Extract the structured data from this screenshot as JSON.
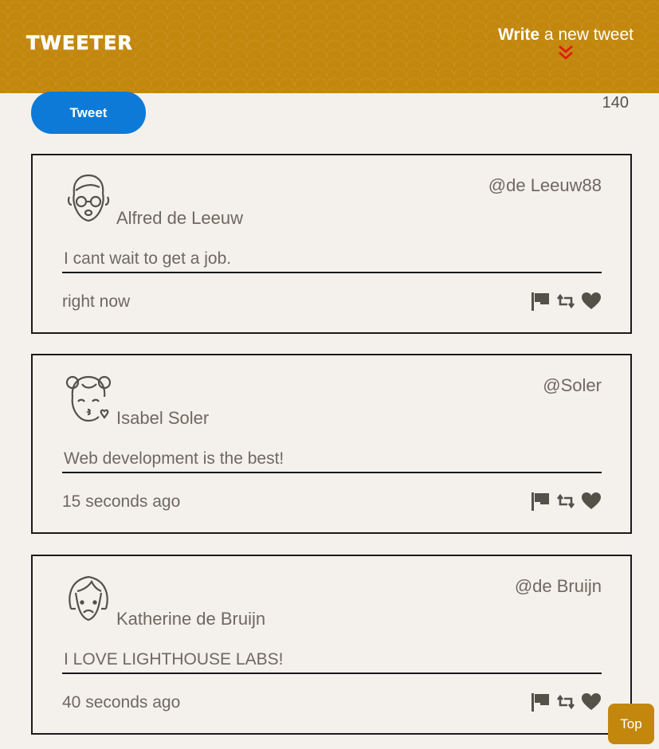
{
  "nav": {
    "brand": "TWEETER",
    "compose_bold": "Write",
    "compose_rest": " a new tweet",
    "compose_icon": "double-chevron-down-icon"
  },
  "composer": {
    "tweet_label": "Tweet",
    "char_count": "140"
  },
  "tweets": [
    {
      "name": "Alfred de Leeuw",
      "handle": "@de Leeuw88",
      "content": "I cant wait to get a job.",
      "time": "right now",
      "avatar": "glasses-person-icon"
    },
    {
      "name": "Isabel Soler",
      "handle": "@Soler",
      "content": "Web development is the best!",
      "time": "15 seconds ago",
      "avatar": "kissing-person-icon"
    },
    {
      "name": "Katherine de Bruijn",
      "handle": "@de Bruijn",
      "content": "I LOVE LIGHTHOUSE LABS!",
      "time": "40 seconds ago",
      "avatar": "sad-person-icon"
    }
  ],
  "scroll_top_label": "Top",
  "colors": {
    "nav_bg": "#c3870e",
    "page_bg": "#f4f1ec",
    "tweet_button": "#0d7ad8",
    "arrow": "#e0190f",
    "text": "#545149"
  }
}
